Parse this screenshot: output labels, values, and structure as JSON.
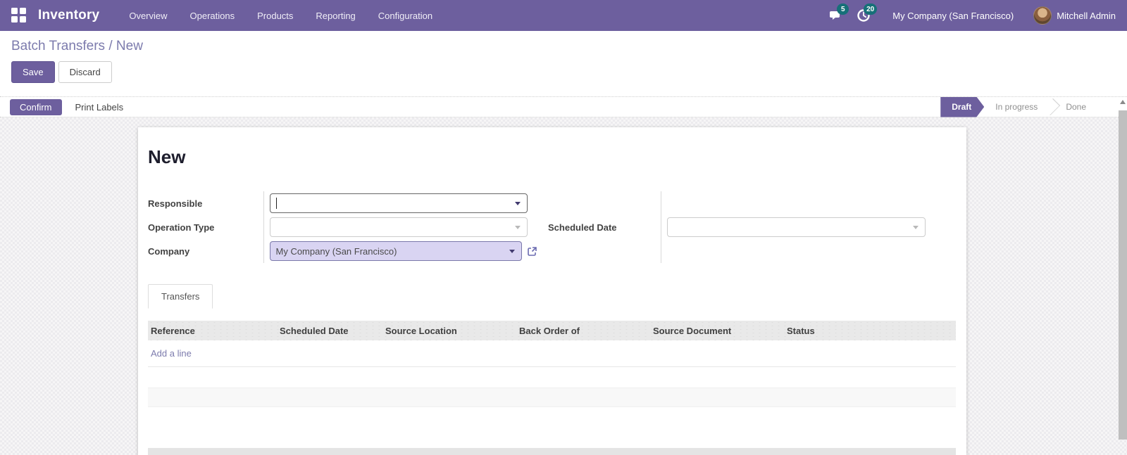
{
  "navbar": {
    "brand": "Inventory",
    "menu": [
      "Overview",
      "Operations",
      "Products",
      "Reporting",
      "Configuration"
    ],
    "messages_badge": "5",
    "activity_badge": "20",
    "company": "My Company (San Francisco)",
    "user": "Mitchell Admin"
  },
  "breadcrumb": {
    "parent": "Batch Transfers",
    "separator": " / ",
    "current": "New"
  },
  "actions": {
    "save": "Save",
    "discard": "Discard"
  },
  "statusbar": {
    "confirm": "Confirm",
    "print_labels": "Print Labels",
    "states": [
      {
        "label": "Draft",
        "active": true
      },
      {
        "label": "In progress",
        "active": false
      },
      {
        "label": "Done",
        "active": false
      }
    ]
  },
  "form": {
    "title": "New",
    "fields": {
      "responsible": {
        "label": "Responsible",
        "value": ""
      },
      "operation_type": {
        "label": "Operation Type",
        "value": ""
      },
      "company": {
        "label": "Company",
        "value": "My Company (San Francisco)"
      },
      "scheduled_date": {
        "label": "Scheduled Date",
        "value": ""
      }
    }
  },
  "notebook": {
    "tabs": [
      {
        "label": "Transfers",
        "active": true
      }
    ]
  },
  "transfers_table": {
    "headers": [
      "Reference",
      "Scheduled Date",
      "Source Location",
      "Back Order of",
      "Source Document",
      "Status"
    ],
    "add_line": "Add a line",
    "rows": []
  },
  "colors": {
    "primary": "#6d5f9e",
    "badge_teal": "#167078",
    "link": "#7c7bad",
    "company_field_bg": "#d9d4f2"
  }
}
